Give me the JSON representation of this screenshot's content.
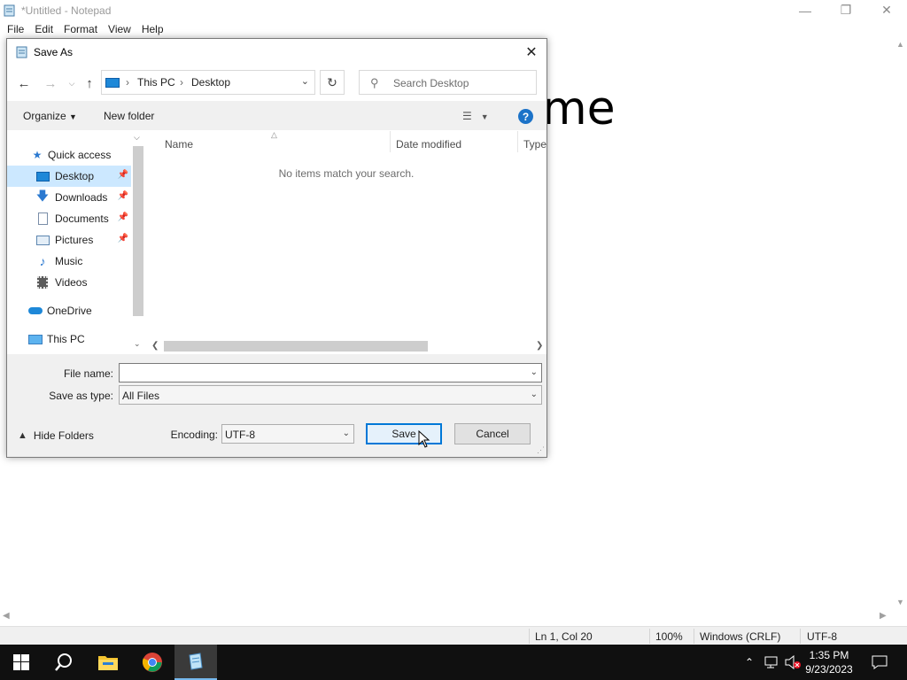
{
  "notepad": {
    "title": "*Untitled - Notepad",
    "menu": [
      "File",
      "Edit",
      "Format",
      "View",
      "Help"
    ],
    "visible_text": "me",
    "status": {
      "position": "Ln 1, Col 20",
      "zoom": "100%",
      "line_ending": "Windows (CRLF)",
      "encoding": "UTF-8"
    }
  },
  "dialog": {
    "title": "Save As",
    "address": {
      "crumbs": [
        "This PC",
        "Desktop"
      ]
    },
    "search": {
      "placeholder": "Search Desktop"
    },
    "toolbar": {
      "organize": "Organize",
      "new_folder": "New folder"
    },
    "nav": {
      "quick_access": "Quick access",
      "items": [
        {
          "label": "Desktop",
          "icon": "desktop-icon",
          "pinned": true,
          "selected": true
        },
        {
          "label": "Downloads",
          "icon": "downloads-icon",
          "pinned": true
        },
        {
          "label": "Documents",
          "icon": "documents-icon",
          "pinned": true
        },
        {
          "label": "Pictures",
          "icon": "pictures-icon",
          "pinned": true
        },
        {
          "label": "Music",
          "icon": "music-icon",
          "pinned": false
        },
        {
          "label": "Videos",
          "icon": "videos-icon",
          "pinned": false
        }
      ],
      "onedrive": "OneDrive",
      "this_pc": "This PC"
    },
    "columns": [
      "Name",
      "Date modified",
      "Type"
    ],
    "empty_message": "No items match your search.",
    "file_name": {
      "label": "File name:",
      "value": ""
    },
    "save_as_type": {
      "label": "Save as type:",
      "value": "All Files"
    },
    "encoding": {
      "label": "Encoding:",
      "value": "UTF-8"
    },
    "hide_folders": "Hide Folders",
    "save_label": "Save",
    "cancel_label": "Cancel"
  },
  "taskbar": {
    "time": "1:35 PM",
    "date": "9/23/2023"
  },
  "colors": {
    "accent": "#0078d7",
    "selection": "#cce8ff",
    "taskbar": "#101010"
  }
}
